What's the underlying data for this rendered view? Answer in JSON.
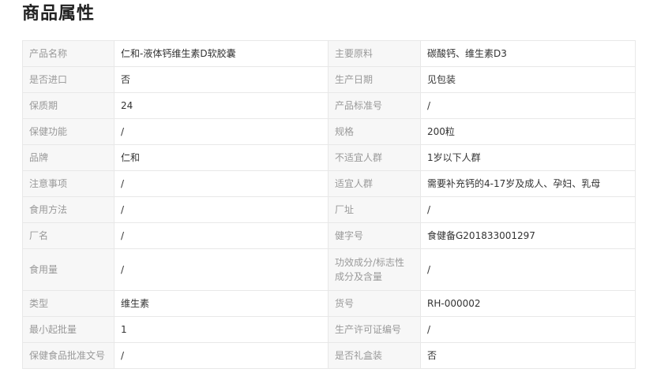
{
  "section": {
    "title": "商品属性"
  },
  "rows": [
    {
      "label1": "产品名称",
      "value1": "仁和-液体钙维生素D软胶囊",
      "label2": "主要原料",
      "value2": "碳酸钙、维生素D3"
    },
    {
      "label1": "是否进口",
      "value1": "否",
      "label2": "生产日期",
      "value2": "见包装"
    },
    {
      "label1": "保质期",
      "value1": "24",
      "label2": "产品标准号",
      "value2": "/"
    },
    {
      "label1": "保健功能",
      "value1": "/",
      "label2": "规格",
      "value2": "200粒"
    },
    {
      "label1": "品牌",
      "value1": "仁和",
      "label2": "不适宜人群",
      "value2": "1岁以下人群"
    },
    {
      "label1": "注意事项",
      "value1": "/",
      "label2": "适宜人群",
      "value2": "需要补充钙的4-17岁及成人、孕妇、乳母"
    },
    {
      "label1": "食用方法",
      "value1": "/",
      "label2": "厂址",
      "value2": "/"
    },
    {
      "label1": "厂名",
      "value1": "/",
      "label2": "健字号",
      "value2": "食健备G201833001297"
    },
    {
      "label1": "食用量",
      "value1": "/",
      "label2": "功效成分/标志性成分及含量",
      "value2": "/"
    },
    {
      "label1": "类型",
      "value1": "维生素",
      "label2": "货号",
      "value2": "RH-000002"
    },
    {
      "label1": "最小起批量",
      "value1": "1",
      "label2": "生产许可证编号",
      "value2": "/"
    },
    {
      "label1": "保健食品批准文号",
      "value1": "/",
      "label2": "是否礼盒装",
      "value2": "否"
    }
  ]
}
